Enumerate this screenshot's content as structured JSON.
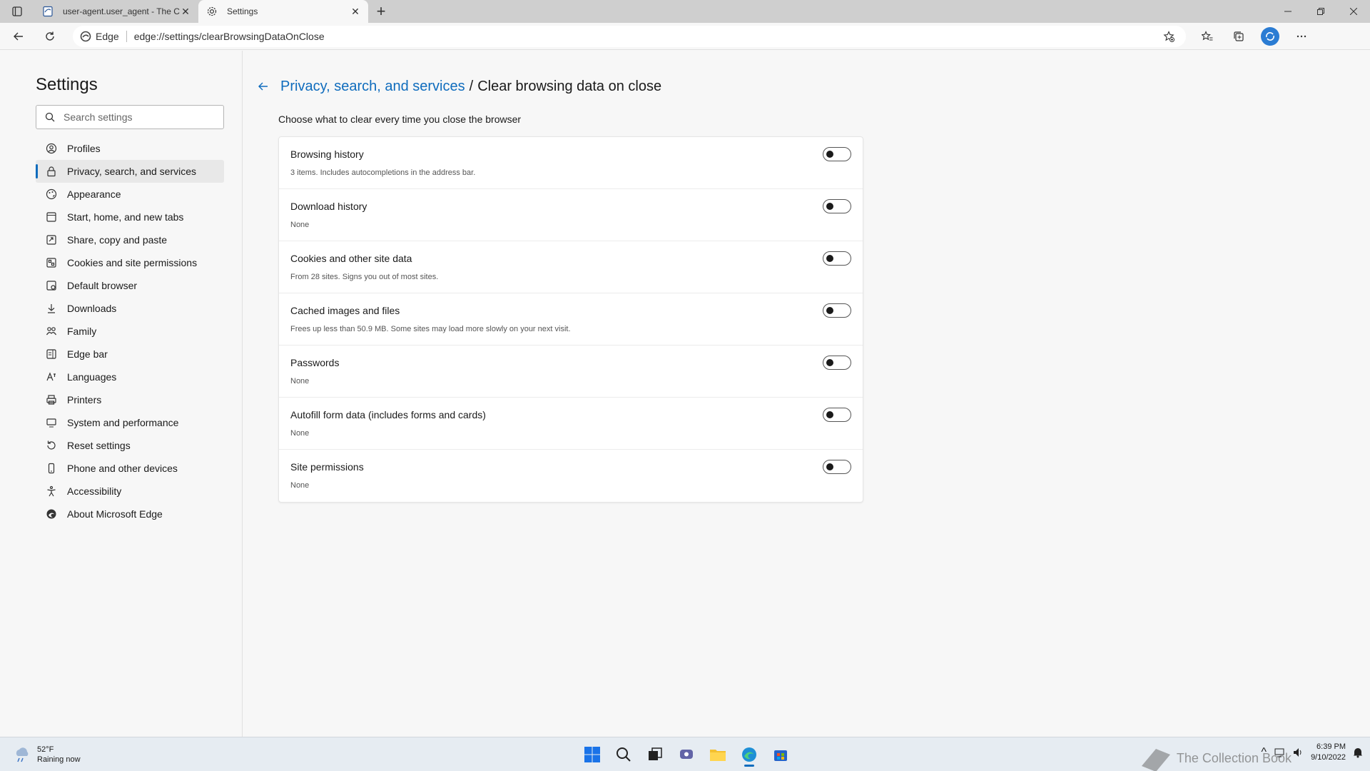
{
  "tabs": [
    {
      "title": "user-agent.user_agent - The Coll",
      "icon": "page-icon",
      "active": false
    },
    {
      "title": "Settings",
      "icon": "gear-icon",
      "active": true
    }
  ],
  "toolbar": {
    "edge_label": "Edge",
    "url": "edge://settings/clearBrowsingDataOnClose"
  },
  "sidebar": {
    "title": "Settings",
    "search_placeholder": "Search settings",
    "items": [
      {
        "label": "Profiles",
        "icon": "profile-icon"
      },
      {
        "label": "Privacy, search, and services",
        "icon": "lock-icon",
        "selected": true
      },
      {
        "label": "Appearance",
        "icon": "appearance-icon"
      },
      {
        "label": "Start, home, and new tabs",
        "icon": "home-icon"
      },
      {
        "label": "Share, copy and paste",
        "icon": "share-icon"
      },
      {
        "label": "Cookies and site permissions",
        "icon": "cookies-icon"
      },
      {
        "label": "Default browser",
        "icon": "browser-icon"
      },
      {
        "label": "Downloads",
        "icon": "download-icon"
      },
      {
        "label": "Family",
        "icon": "family-icon"
      },
      {
        "label": "Edge bar",
        "icon": "edge-bar-icon"
      },
      {
        "label": "Languages",
        "icon": "languages-icon"
      },
      {
        "label": "Printers",
        "icon": "printer-icon"
      },
      {
        "label": "System and performance",
        "icon": "system-icon"
      },
      {
        "label": "Reset settings",
        "icon": "reset-icon"
      },
      {
        "label": "Phone and other devices",
        "icon": "phone-icon"
      },
      {
        "label": "Accessibility",
        "icon": "accessibility-icon"
      },
      {
        "label": "About Microsoft Edge",
        "icon": "edge-logo-icon"
      }
    ]
  },
  "main": {
    "breadcrumb_parent": "Privacy, search, and services",
    "breadcrumb_separator": "/",
    "breadcrumb_current": "Clear browsing data on close",
    "subtitle": "Choose what to clear every time you close the browser",
    "rows": [
      {
        "title": "Browsing history",
        "desc": "3 items. Includes autocompletions in the address bar.",
        "on": false
      },
      {
        "title": "Download history",
        "desc": "None",
        "on": false
      },
      {
        "title": "Cookies and other site data",
        "desc": "From 28 sites. Signs you out of most sites.",
        "on": false
      },
      {
        "title": "Cached images and files",
        "desc": "Frees up less than 50.9 MB. Some sites may load more slowly on your next visit.",
        "on": false
      },
      {
        "title": "Passwords",
        "desc": "None",
        "on": false
      },
      {
        "title": "Autofill form data (includes forms and cards)",
        "desc": "None",
        "on": false
      },
      {
        "title": "Site permissions",
        "desc": "None",
        "on": false
      }
    ]
  },
  "taskbar": {
    "weather_temp": "52°F",
    "weather_desc": "Raining now",
    "time": "6:39 PM",
    "date": "9/10/2022",
    "watermark": "The Collection Book"
  },
  "colors": {
    "accent": "#0f6cbd",
    "background": "#f7f7f7",
    "tabstrip": "#cfcfcf"
  }
}
